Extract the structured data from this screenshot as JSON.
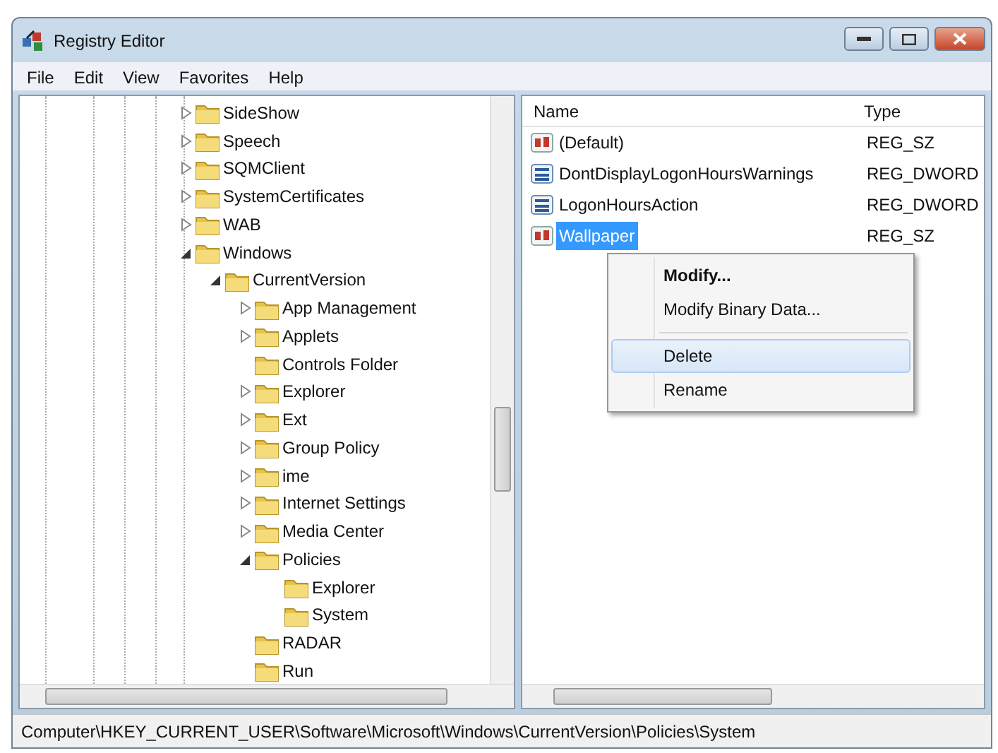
{
  "window": {
    "title": "Registry Editor"
  },
  "menu": [
    "File",
    "Edit",
    "View",
    "Favorites",
    "Help"
  ],
  "tree": [
    {
      "label": "SideShow",
      "expanded": false
    },
    {
      "label": "Speech",
      "expanded": false
    },
    {
      "label": "SQMClient",
      "expanded": false
    },
    {
      "label": "SystemCertificates",
      "expanded": false
    },
    {
      "label": "WAB",
      "expanded": false
    },
    {
      "label": "Windows",
      "expanded": true,
      "children": [
        {
          "label": "CurrentVersion",
          "expanded": true,
          "children": [
            {
              "label": "App Management",
              "expanded": false
            },
            {
              "label": "Applets",
              "expanded": false
            },
            {
              "label": "Controls Folder"
            },
            {
              "label": "Explorer",
              "expanded": false
            },
            {
              "label": "Ext",
              "expanded": false
            },
            {
              "label": "Group Policy",
              "expanded": false
            },
            {
              "label": "ime",
              "expanded": false
            },
            {
              "label": "Internet Settings",
              "expanded": false
            },
            {
              "label": "Media Center",
              "expanded": false
            },
            {
              "label": "Policies",
              "expanded": true,
              "children": [
                {
                  "label": "Explorer"
                },
                {
                  "label": "System"
                }
              ]
            },
            {
              "label": "RADAR"
            },
            {
              "label": "Run"
            }
          ]
        }
      ]
    }
  ],
  "values": {
    "columns": [
      "Name",
      "Type"
    ],
    "rows": [
      {
        "name": "(Default)",
        "type": "REG_SZ",
        "kind": "string",
        "selected": false
      },
      {
        "name": "DontDisplayLogonHoursWarnings",
        "type": "REG_DWORD",
        "kind": "dword",
        "selected": false
      },
      {
        "name": "LogonHoursAction",
        "type": "REG_DWORD",
        "kind": "dword",
        "selected": false
      },
      {
        "name": "Wallpaper",
        "type": "REG_SZ",
        "kind": "string",
        "selected": true
      }
    ]
  },
  "context_menu": [
    {
      "kind": "item",
      "label": "Modify...",
      "default": true,
      "selected": false
    },
    {
      "kind": "item",
      "label": "Modify Binary Data...",
      "default": false,
      "selected": false
    },
    {
      "kind": "separator"
    },
    {
      "kind": "item",
      "label": "Delete",
      "default": false,
      "selected": true
    },
    {
      "kind": "item",
      "label": "Rename",
      "default": false,
      "selected": false
    }
  ],
  "status_bar": "Computer\\HKEY_CURRENT_USER\\Software\\Microsoft\\Windows\\CurrentVersion\\Policies\\System"
}
